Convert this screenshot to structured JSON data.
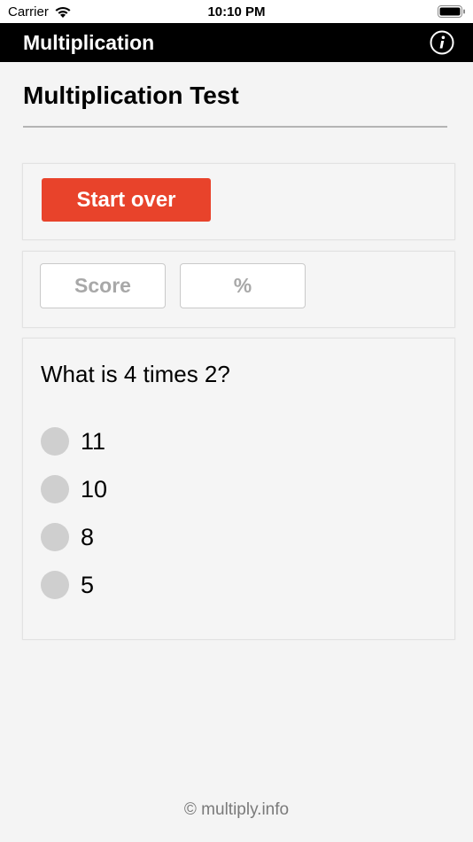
{
  "status_bar": {
    "carrier": "Carrier",
    "time": "10:10 PM"
  },
  "nav": {
    "title": "Multiplication",
    "info_icon": "info-icon"
  },
  "page": {
    "title": "Multiplication Test"
  },
  "controls": {
    "start_over_label": "Start over",
    "start_over_color": "#e8432b"
  },
  "score": {
    "score_label": "Score",
    "percent_label": "%"
  },
  "question": {
    "text": "What is 4 times 2?",
    "options": [
      "11",
      "10",
      "8",
      "5"
    ]
  },
  "footer": {
    "text": "© multiply.info"
  }
}
